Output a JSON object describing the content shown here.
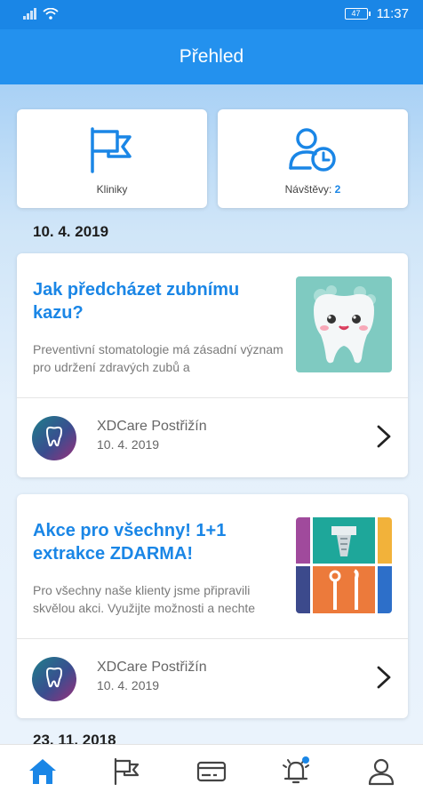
{
  "status_bar": {
    "time": "11:37",
    "battery": "47"
  },
  "header": {
    "title": "Přehled"
  },
  "tiles": [
    {
      "label": "Kliniky"
    },
    {
      "label": "Návštěvy:",
      "count": "2"
    }
  ],
  "sections": [
    {
      "date": "10. 4. 2019"
    },
    {
      "date": "23. 11. 2018"
    }
  ],
  "articles": [
    {
      "title": "Jak předcházet zubnímu kazu?",
      "description": "Preventivní stomatologie má zásadní význam pro udržení zdravých zubů a",
      "clinic": "XDCare Postřižín",
      "date": "10. 4. 2019"
    },
    {
      "title": "Akce pro všechny! 1+1 extrakce ZDARMA!",
      "description": "Pro všechny naše klienty jsme připravili skvělou akci. Využijte možnosti a nechte",
      "clinic": "XDCare Postřižín",
      "date": "10. 4. 2019"
    }
  ],
  "bottom_nav": {
    "items": [
      "home-icon",
      "flag-icon",
      "card-icon",
      "bell-icon",
      "profile-icon"
    ],
    "active": "home-icon"
  },
  "colors": {
    "accent": "#2391ee",
    "status_bar": "#1a86e6",
    "active_nav": "#1a86e6"
  }
}
